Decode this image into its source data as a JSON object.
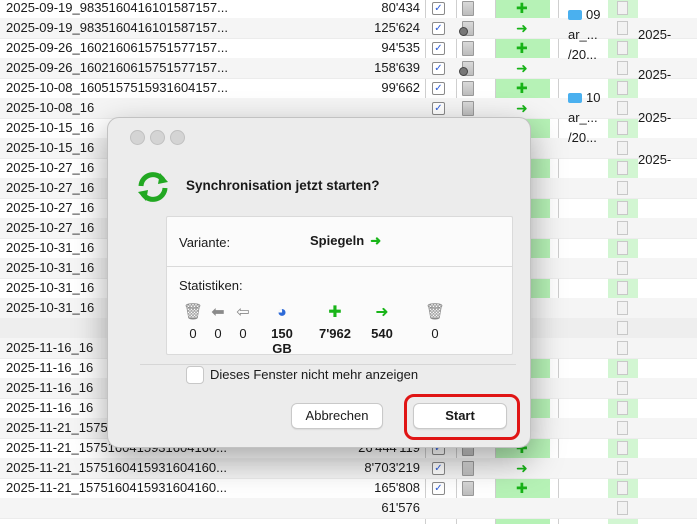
{
  "rows": [
    {
      "name": "2025-09-19_9835160416101587157...",
      "size": "80'434",
      "cd": false
    },
    {
      "name": "2025-09-19_9835160416101587157...",
      "size": "125'624",
      "cd": true
    },
    {
      "name": "2025-09-26_1602160615751577157...",
      "size": "94'535",
      "cd": false
    },
    {
      "name": "2025-09-26_1602160615751577157...",
      "size": "158'639",
      "cd": true
    },
    {
      "name": "2025-10-08_1605157515931604157...",
      "size": "99'662",
      "cd": false
    },
    {
      "name": "2025-10-08_16",
      "size": "",
      "cd": false
    },
    {
      "name": "2025-10-15_16",
      "size": "",
      "cd": false
    },
    {
      "name": "2025-10-15_16",
      "size": "",
      "cd": false
    },
    {
      "name": "2025-10-27_16",
      "size": "",
      "cd": false
    },
    {
      "name": "2025-10-27_16",
      "size": "",
      "cd": false
    },
    {
      "name": "2025-10-27_16",
      "size": "",
      "cd": false
    },
    {
      "name": "2025-10-27_16",
      "size": "",
      "cd": false
    },
    {
      "name": "2025-10-31_16",
      "size": "",
      "cd": false
    },
    {
      "name": "2025-10-31_16",
      "size": "",
      "cd": false
    },
    {
      "name": "2025-10-31_16",
      "size": "",
      "cd": false
    },
    {
      "name": "2025-10-31_16",
      "size": "",
      "cd": false
    },
    {
      "name": "",
      "size": "",
      "cd": false
    },
    {
      "name": "2025-11-16_16",
      "size": "",
      "cd": false
    },
    {
      "name": "2025-11-16_16",
      "size": "",
      "cd": false
    },
    {
      "name": "2025-11-16_16",
      "size": "",
      "cd": false
    },
    {
      "name": "2025-11-16_16",
      "size": "",
      "cd": false
    },
    {
      "name": "2025-11-21_1575160415931604160...",
      "size": "",
      "cd": false
    },
    {
      "name": "2025-11-21_1575160415931604160...",
      "size": "26'444'119",
      "cd": false
    },
    {
      "name": "2025-11-21_1575160415931604160...",
      "size": "8'703'219",
      "cd": false
    },
    {
      "name": "2025-11-21_1575160415931604160...",
      "size": "165'808",
      "cd": false
    },
    {
      "name": "",
      "size": "61'576",
      "cd": false
    }
  ],
  "right": {
    "group1": {
      "folder": "09",
      "line2": "ar_...",
      "line3": "/20...",
      "date1": "2025-",
      "date2": "2025-"
    },
    "group2": {
      "folder": "10",
      "line2": "ar_...",
      "line3": "/20...",
      "date1": "2025-",
      "date2": "2025-"
    }
  },
  "dialog": {
    "title": "Synchronisation jetzt starten?",
    "variant_label": "Variante:",
    "variant_value": "Spiegeln",
    "stats_label": "Statistiken:",
    "stats": [
      {
        "icon": "delete-left-icon",
        "value": "0",
        "bold": false
      },
      {
        "icon": "arrow-left-icon",
        "value": "0",
        "bold": false
      },
      {
        "icon": "arrow-left-update-icon",
        "value": "0",
        "bold": false
      },
      {
        "icon": "pie-chart-icon",
        "value": "150 GB",
        "bold": true
      },
      {
        "icon": "create-right-icon",
        "value": "7'962",
        "bold": true
      },
      {
        "icon": "arrow-right-icon",
        "value": "540",
        "bold": true
      },
      {
        "icon": "delete-right-icon",
        "value": "0",
        "bold": false
      }
    ],
    "checkbox_label": "Dieses Fenster nicht mehr anzeigen",
    "cancel_label": "Abbrechen",
    "start_label": "Start"
  },
  "colors": {
    "accent_green": "#19b519",
    "highlight": "#e01515",
    "green_column": "#b6f2b6"
  }
}
